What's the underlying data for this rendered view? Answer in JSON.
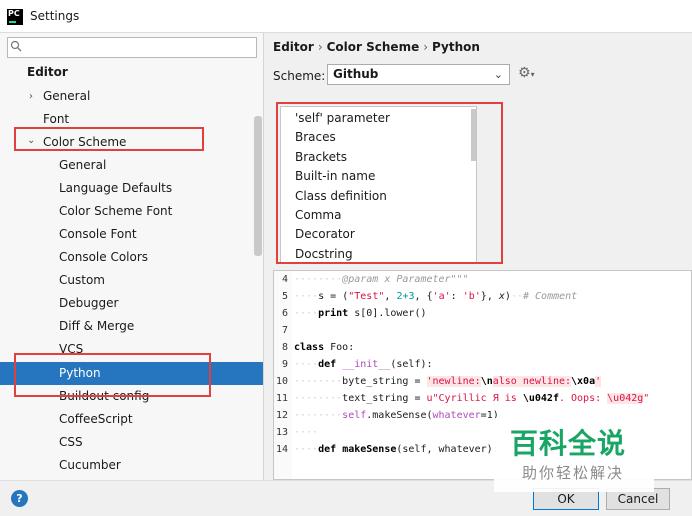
{
  "window": {
    "title": "Settings",
    "app_icon_text": "PC"
  },
  "sidebar": {
    "search_placeholder": "",
    "items": [
      {
        "label": "Editor"
      },
      {
        "label": "General"
      },
      {
        "label": "Font"
      },
      {
        "label": "Color Scheme"
      },
      {
        "label": "General"
      },
      {
        "label": "Language Defaults"
      },
      {
        "label": "Color Scheme Font"
      },
      {
        "label": "Console Font"
      },
      {
        "label": "Console Colors"
      },
      {
        "label": "Custom"
      },
      {
        "label": "Debugger"
      },
      {
        "label": "Diff & Merge"
      },
      {
        "label": "VCS"
      },
      {
        "label": "Python"
      },
      {
        "label": "Buildout config"
      },
      {
        "label": "CoffeeScript"
      },
      {
        "label": "CSS"
      },
      {
        "label": "Cucumber"
      }
    ],
    "selected": "Python"
  },
  "breadcrumb": {
    "part1": "Editor",
    "part2": "Color Scheme",
    "part3": "Python",
    "separator": "›"
  },
  "scheme": {
    "label": "Scheme:",
    "value": "Github"
  },
  "elements_list": {
    "items": [
      "'self' parameter",
      "Braces",
      "Brackets",
      "Built-in name",
      "Class definition",
      "Comma",
      "Decorator",
      "Docstring"
    ]
  },
  "code_preview": {
    "line_numbers": [
      "4",
      "5",
      "6",
      "7",
      "8",
      "9",
      "10",
      "11",
      "12",
      "13",
      "14"
    ],
    "l4": {
      "docstring": "@param x Parameter\"\"\""
    },
    "l5": {
      "var": "s",
      "eq": "=",
      "p1": "(",
      "s1": "\"Test\"",
      "c1": ",",
      "n1": "2+3",
      "c2": ",",
      "b1": "{",
      "s2": "'a'",
      "colon": ":",
      "s3": "'b'",
      "b2": "}",
      "c3": ",",
      "x": "x",
      "p2": ")",
      "comment": "# Comment"
    },
    "l6": {
      "kw": "print",
      "rest": "s[0].lower()"
    },
    "l8": {
      "kw": "class",
      "name": "Foo:"
    },
    "l9": {
      "kw": "def",
      "name": "__init__",
      "args": "(self):"
    },
    "l10": {
      "var": "byte_string",
      "eq": "=",
      "s1": "'newline:",
      "esc1": "\\n",
      "s2": "also newline:",
      "esc2": "\\x0a",
      "s3": "'"
    },
    "l11": {
      "var": "text_string",
      "eq": "=",
      "s1": "u\"Cyrillic Я is",
      "esc1": "\\u042f",
      "s2": ". Oops:",
      "bad": "\\u042g",
      "s3": "\""
    },
    "l12": {
      "self": "self",
      "call": ".makeSense(",
      "kwarg": "whatever",
      "val": "=1)"
    },
    "l14": {
      "kw": "def",
      "name": "makeSense",
      "args": "(self, whatever):"
    }
  },
  "buttons": {
    "help": "?",
    "ok": "OK",
    "cancel": "Cancel"
  },
  "watermark": {
    "main": "百科全说",
    "sub": "助你轻松解决"
  },
  "colors": {
    "selection": "#2675bf",
    "highlight_box": "#e0403e",
    "watermark_green": "#19a564"
  }
}
